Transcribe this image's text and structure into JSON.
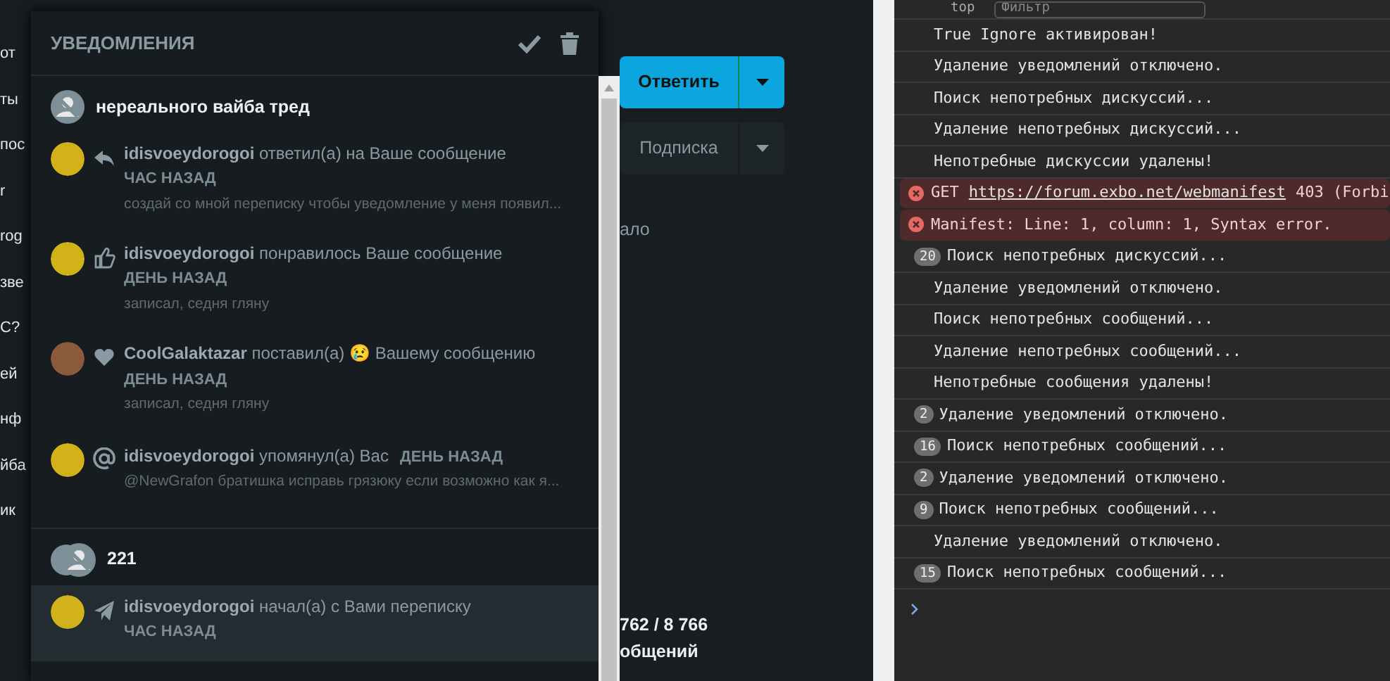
{
  "page_fragments": {
    "left": [
      "от",
      "ты",
      "пос",
      "r",
      "rog",
      "зве",
      "С?",
      "ей",
      "нф",
      "йба",
      "ик"
    ],
    "reply_button": "Ответить",
    "subscribe_button": "Подписка",
    "caption": "ало",
    "stats": "762 / 8 766",
    "stats_label": "общений"
  },
  "notifications": {
    "title": "УВЕДОМЛЕНИЯ",
    "groups": [
      {
        "title": "нереального вайба тред",
        "items": [
          {
            "kind": "reply",
            "color": "#d2b21a",
            "user": "idisvoeydorogoi",
            "action": "ответил(а) на Ваше сообщение",
            "time": "ЧАС НАЗАД",
            "excerpt": "создай со мной переписку чтобы уведомление у меня появил...",
            "inline_time": false,
            "unread": false
          },
          {
            "kind": "like",
            "color": "#d2b21a",
            "user": "idisvoeydorogoi",
            "action": "понравилось Ваше сообщение",
            "time": "ДЕНЬ НАЗАД",
            "excerpt": "записал, седня гляну",
            "inline_time": false,
            "unread": false
          },
          {
            "kind": "reaction",
            "color": "#8a5a3a",
            "user": "CoolGalaktazar",
            "action": "поставил(а) 😢 Вашему сообщению",
            "time": "ДЕНЬ НАЗАД",
            "excerpt": "записал, седня гляну",
            "inline_time": false,
            "unread": false
          },
          {
            "kind": "mention",
            "color": "#d2b21a",
            "user": "idisvoeydorogoi",
            "action": "упомянул(а) Вас",
            "time": "ДЕНЬ НАЗАД",
            "excerpt": "@NewGrafon братишка исправь грязюку если возможно как я...",
            "inline_time": true,
            "unread": false
          }
        ]
      },
      {
        "title": "221",
        "items": [
          {
            "kind": "conversation",
            "color": "#d2b21a",
            "user": "idisvoeydorogoi",
            "action": "начал(а) с Вами переписку",
            "time": "ЧАС НАЗАД",
            "inline_time": false,
            "unread": true
          }
        ]
      }
    ]
  },
  "console": {
    "context": "top",
    "filter": {
      "placeholder": "Фильтр"
    },
    "rows": [
      {
        "kind": "log",
        "text": "True Ignore активирован!"
      },
      {
        "kind": "log",
        "text": "Удаление уведомлений отключено."
      },
      {
        "kind": "log",
        "text": "Поиск непотребных дискуссий..."
      },
      {
        "kind": "log",
        "text": "Удаление непотребных дискуссий..."
      },
      {
        "kind": "log",
        "text": "Непотребные дискуссии удалены!"
      },
      {
        "kind": "error",
        "text": "GET",
        "link": "https://forum.exbo.net/webmanifest",
        "tail": "403 (Forbi"
      },
      {
        "kind": "error",
        "text": "Manifest: Line: 1, column: 1, Syntax error."
      },
      {
        "kind": "log",
        "count": "20",
        "text": "Поиск непотребных дискуссий..."
      },
      {
        "kind": "log",
        "text": "Удаление уведомлений отключено."
      },
      {
        "kind": "log",
        "text": "Поиск непотребных сообщений..."
      },
      {
        "kind": "log",
        "text": "Удаление непотребных сообщений..."
      },
      {
        "kind": "log",
        "text": "Непотребные сообщения удалены!"
      },
      {
        "kind": "log",
        "count": "2",
        "text": "Удаление уведомлений отключено."
      },
      {
        "kind": "log",
        "count": "16",
        "text": "Поиск непотребных сообщений..."
      },
      {
        "kind": "log",
        "count": "2",
        "text": "Удаление уведомлений отключено."
      },
      {
        "kind": "log",
        "count": "9",
        "text": "Поиск непотребных сообщений..."
      },
      {
        "kind": "log",
        "text": "Удаление уведомлений отключено."
      },
      {
        "kind": "log",
        "count": "15",
        "text": "Поиск непотребных сообщений..."
      }
    ]
  }
}
